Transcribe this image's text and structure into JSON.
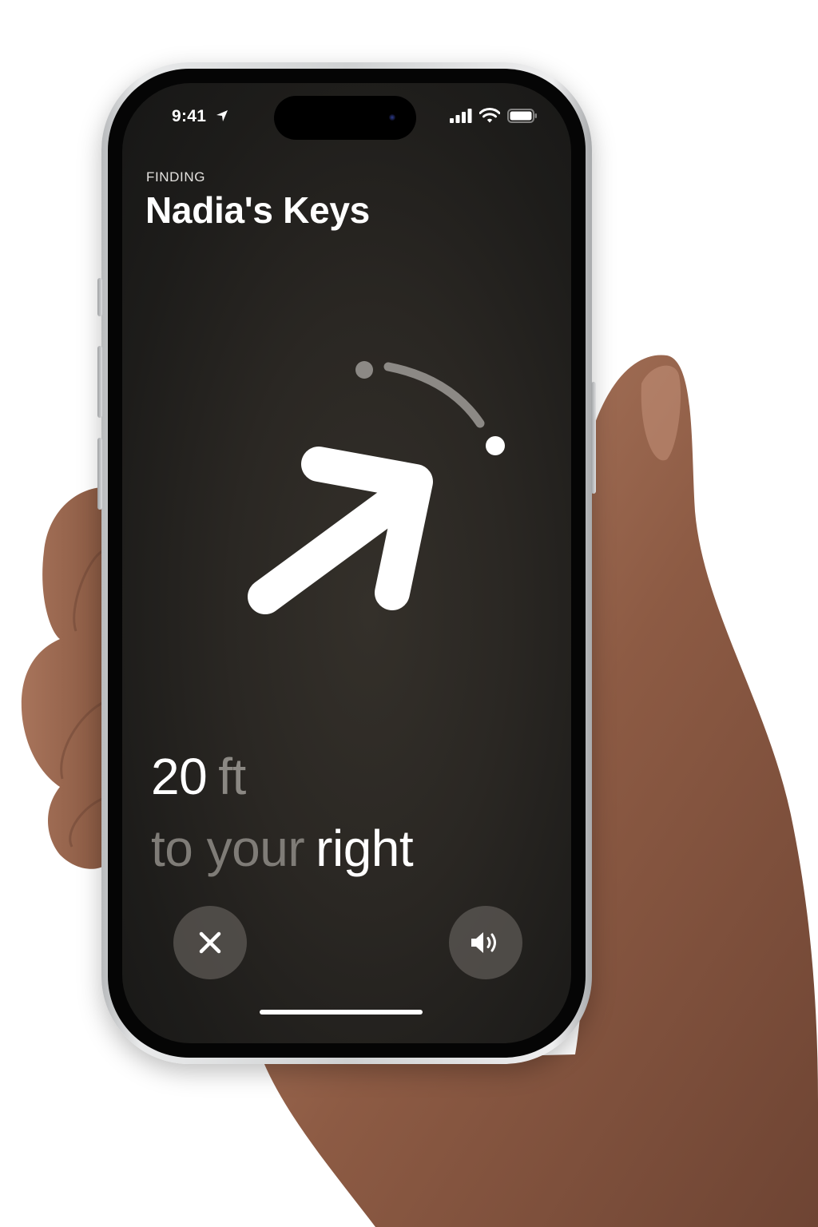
{
  "status_bar": {
    "time": "9:41",
    "icons": [
      "location-arrow-icon",
      "cellular-signal-icon",
      "wifi-icon",
      "battery-icon"
    ]
  },
  "header": {
    "eyebrow": "FINDING",
    "title": "Nadia's Keys"
  },
  "direction": {
    "distance_value": "20",
    "distance_unit": "ft",
    "phrase_lead": "to your",
    "phrase_emphasis": "right",
    "arrow_icon": "direction-arrow-icon"
  },
  "controls": {
    "close_icon": "close-icon",
    "sound_icon": "speaker-icon"
  },
  "colors": {
    "screen_background": "#2a2723",
    "primary_text": "#ffffff",
    "secondary_text": "#7f7c77",
    "button_background": "#5f5c58"
  }
}
